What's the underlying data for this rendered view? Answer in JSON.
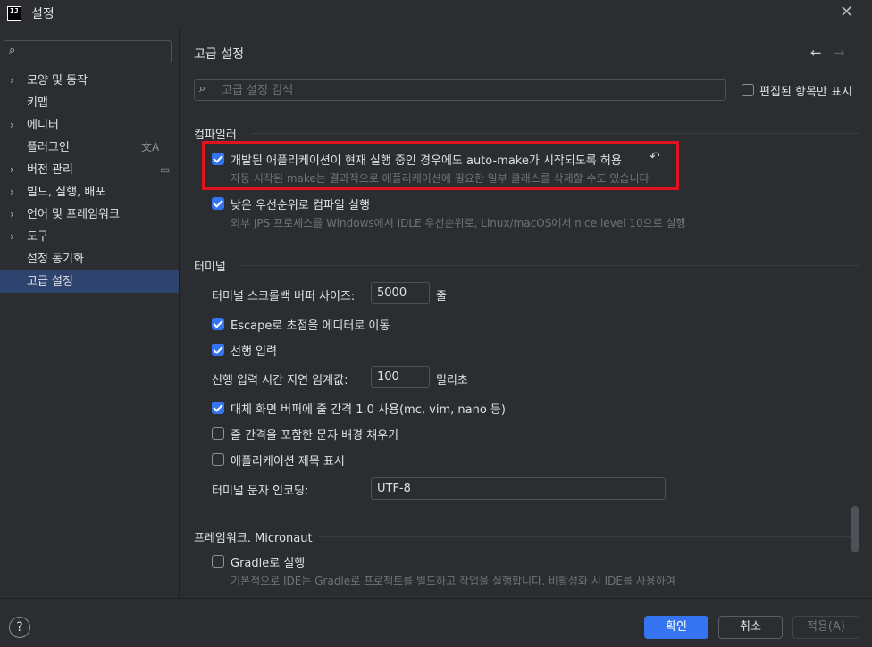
{
  "window": {
    "title": "설정",
    "app_icon": "IJ"
  },
  "sidebar": {
    "search_value": "",
    "items": [
      {
        "label": "모양 및 동작",
        "expandable": true
      },
      {
        "label": "키맵",
        "expandable": false
      },
      {
        "label": "에디터",
        "expandable": true
      },
      {
        "label": "플러그인",
        "expandable": false,
        "right_icon": "translate-icon",
        "right_glyph": "文A"
      },
      {
        "label": "버전 관리",
        "expandable": true,
        "right_icon": "window-icon",
        "right_glyph": "▭"
      },
      {
        "label": "빌드, 실행, 배포",
        "expandable": true
      },
      {
        "label": "언어 및 프레임워크",
        "expandable": true
      },
      {
        "label": "도구",
        "expandable": true
      },
      {
        "label": "설정 동기화",
        "expandable": false
      },
      {
        "label": "고급 설정",
        "expandable": false,
        "selected": true
      }
    ]
  },
  "main": {
    "title": "고급 설정",
    "search_placeholder": "고급 설정 검색",
    "only_modified_label": "편집된 항목만 표시",
    "compiler": {
      "title": "컴파일러",
      "auto_make_label": "개발된 애플리케이션이 현재 실행 중인 경우에도 auto-make가 시작되도록 허용",
      "auto_make_hint": "자동 시작된 make는 결과적으로 애플리케이션에 필요한 일부 클래스를 삭제할 수도 있습니다",
      "low_priority_label": "낮은 우선순위로 컴파일 실행",
      "low_priority_hint": "외부 JPS 프로세스를 Windows에서 IDLE 우선순위로, Linux/macOS에서 nice level 10으로 실행"
    },
    "terminal": {
      "title": "터미널",
      "scroll_buffer_label": "터미널 스크롤백 버퍼 사이즈:",
      "scroll_buffer_value": "5000",
      "scroll_buffer_unit": "줄",
      "escape_label": "Escape로 초점을 에디터로 이동",
      "typeahead_label": "선행 입력",
      "typeahead_delay_label": "선행 입력 시간 지연 임계값:",
      "typeahead_delay_value": "100",
      "typeahead_delay_unit": "밀리초",
      "alt_buffer_label": "대체 화면 버퍼에 줄 간격 1.0 사용(mc, vim, nano 등)",
      "fill_bg_label": "줄 간격을 포함한 문자 배경 채우기",
      "show_app_title_label": "애플리케이션 제목 표시",
      "encoding_label": "터미널 문자 인코딩:",
      "encoding_value": "UTF-8"
    },
    "micronaut": {
      "title": "프레임워크. Micronaut",
      "gradle_label": "Gradle로 실행",
      "gradle_hint": "기본적으로 IDE는 Gradle로 프로젝트를 빌드하고 작업을 실행합니다. 비활성화 시 IDE를 사용하여"
    }
  },
  "buttons": {
    "help": "?",
    "ok": "확인",
    "cancel": "취소",
    "apply": "적용(A)"
  },
  "colors": {
    "accent": "#3574f0",
    "highlight_border": "#e0141e",
    "background": "#2b2d30",
    "selection": "#2e436e"
  }
}
